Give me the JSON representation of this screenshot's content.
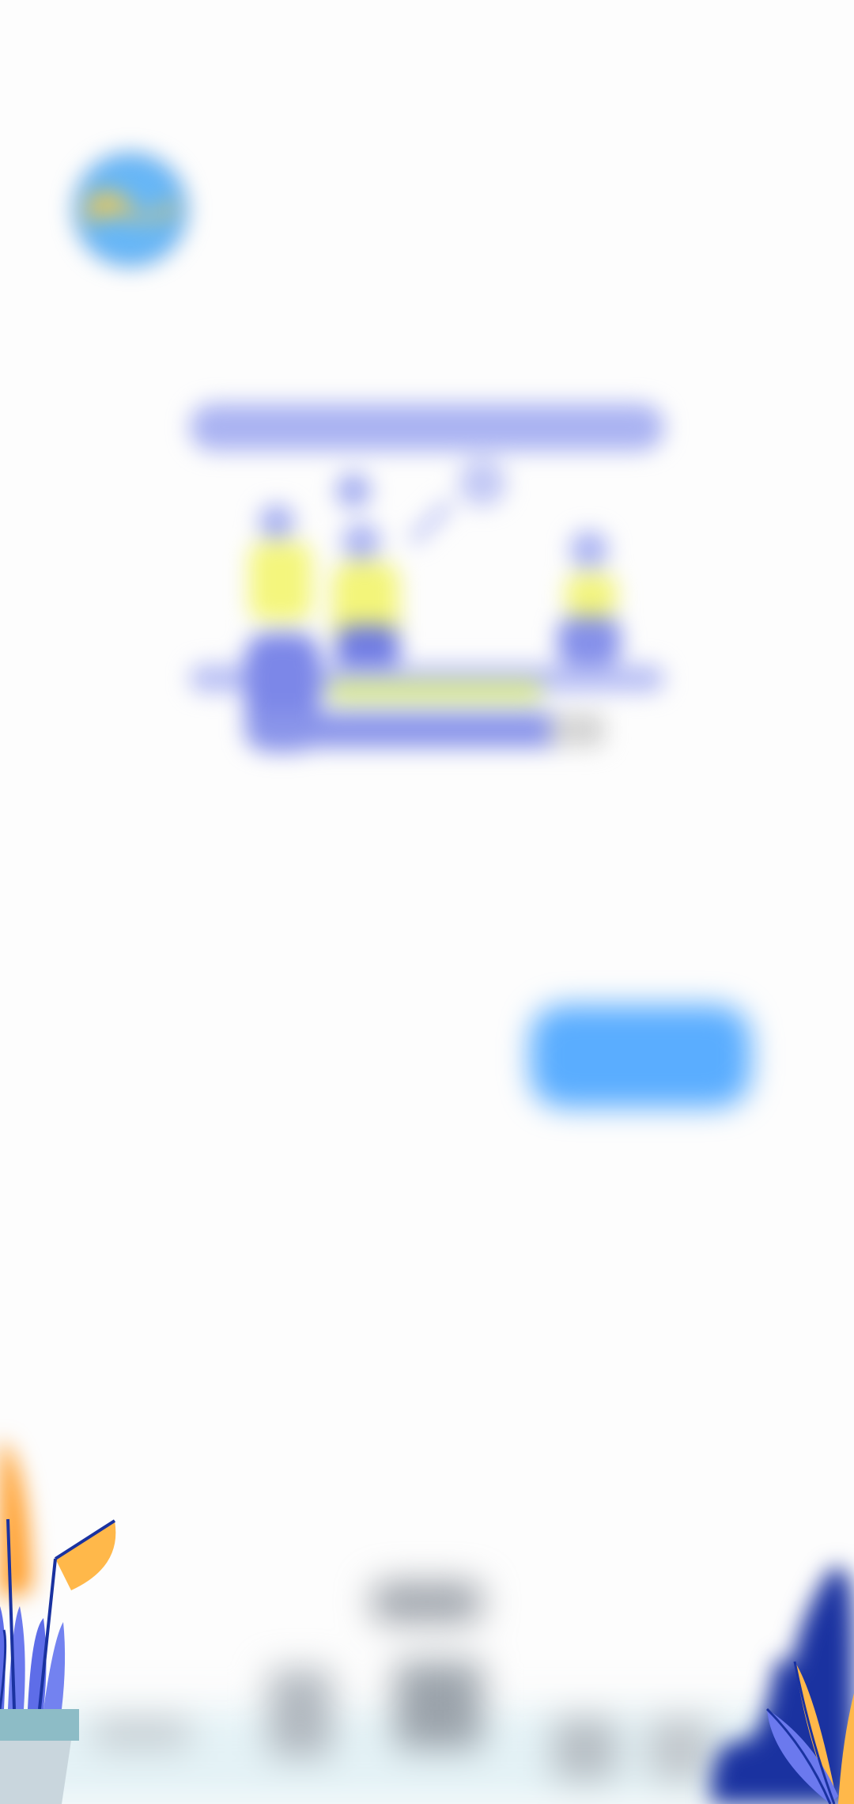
{
  "header": {
    "logo_icon": "globe-logo-icon",
    "institute_name_line1": "",
    "institute_name_line2": ""
  },
  "illustration": {
    "icon": "team-at-desk-illustration"
  },
  "prompt": {
    "text": ""
  },
  "actions": {
    "secondary_link_label": "",
    "primary_button_label": ""
  },
  "footer": {
    "left_plant_icon": "potted-plant-icon",
    "right_plant_icon": "leafy-plant-icon",
    "cityscape_icon": "city-skyline-icon"
  },
  "colors": {
    "primary": "#5aadff",
    "illustration_blue": "#7a86e6",
    "illustration_yellow": "#f3f57a",
    "plant_orange": "#ff9b24",
    "plant_navy": "#1a32a0"
  }
}
